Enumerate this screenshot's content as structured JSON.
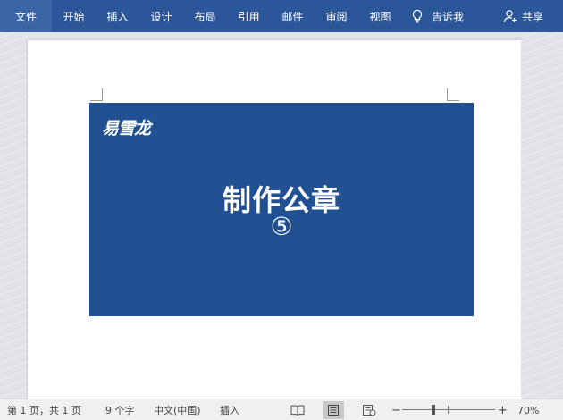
{
  "ribbon": {
    "tabs": [
      "文件",
      "开始",
      "插入",
      "设计",
      "布局",
      "引用",
      "邮件",
      "审阅",
      "视图"
    ],
    "tell_me": "告诉我",
    "share": "共享",
    "bg_color": "#2b579a"
  },
  "document": {
    "brand": "易雪龙",
    "title": "制作公章",
    "number": "⑤",
    "banner_color": "#215193"
  },
  "status_bar": {
    "page_info": "第 1 页，共 1 页",
    "word_count": "9 个字",
    "language": "中文(中国)",
    "mode": "插入",
    "zoom_minus": "−",
    "zoom_plus": "+",
    "zoom": "70%",
    "zoom_fraction": 0.7
  }
}
